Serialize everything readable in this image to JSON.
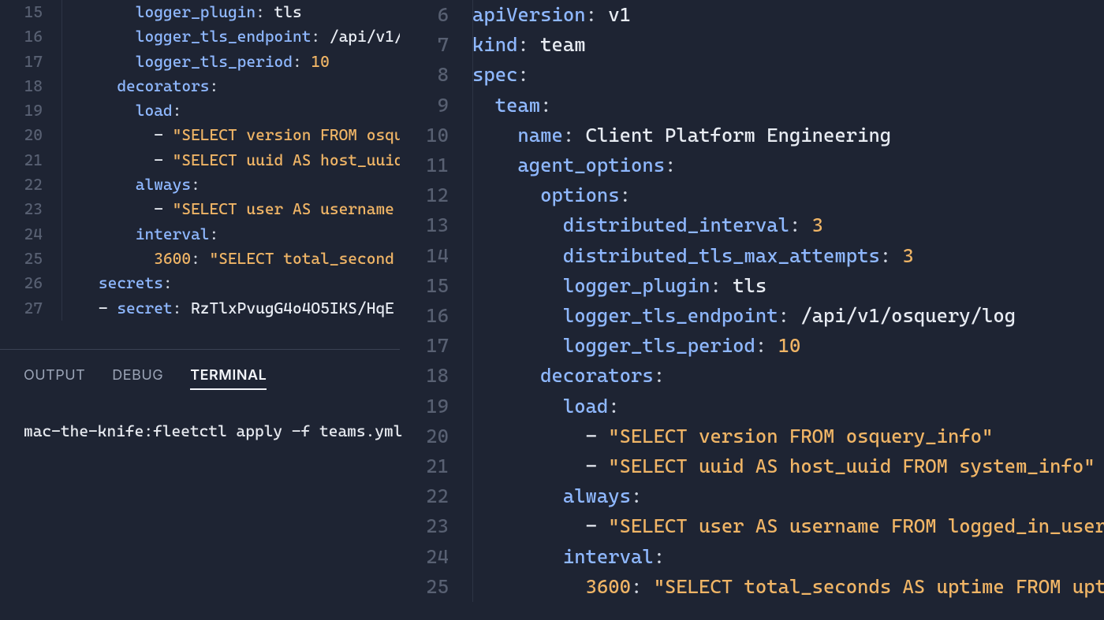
{
  "left_editor": {
    "start": 15,
    "indent_guide_col": 78,
    "lines": [
      [
        [
          "        ",
          "punct"
        ],
        [
          "logger_plugin",
          "key"
        ],
        [
          ": ",
          "punct"
        ],
        [
          "tls",
          "val"
        ]
      ],
      [
        [
          "        ",
          "punct"
        ],
        [
          "logger_tls_endpoint",
          "key"
        ],
        [
          ": ",
          "punct"
        ],
        [
          "/api/v1/",
          "val"
        ]
      ],
      [
        [
          "        ",
          "punct"
        ],
        [
          "logger_tls_period",
          "key"
        ],
        [
          ": ",
          "punct"
        ],
        [
          "10",
          "num"
        ]
      ],
      [
        [
          "      ",
          "punct"
        ],
        [
          "decorators",
          "key"
        ],
        [
          ":",
          "punct"
        ]
      ],
      [
        [
          "        ",
          "punct"
        ],
        [
          "load",
          "key"
        ],
        [
          ":",
          "punct"
        ]
      ],
      [
        [
          "          ",
          "punct"
        ],
        [
          "- ",
          "dash"
        ],
        [
          "\"SELECT version FROM osqu",
          "str"
        ]
      ],
      [
        [
          "          ",
          "punct"
        ],
        [
          "- ",
          "dash"
        ],
        [
          "\"SELECT uuid AS host_uuid",
          "str"
        ]
      ],
      [
        [
          "        ",
          "punct"
        ],
        [
          "always",
          "key"
        ],
        [
          ":",
          "punct"
        ]
      ],
      [
        [
          "          ",
          "punct"
        ],
        [
          "- ",
          "dash"
        ],
        [
          "\"SELECT user AS username",
          "str"
        ]
      ],
      [
        [
          "        ",
          "punct"
        ],
        [
          "interval",
          "key"
        ],
        [
          ":",
          "punct"
        ]
      ],
      [
        [
          "          ",
          "punct"
        ],
        [
          "3600",
          "num"
        ],
        [
          ": ",
          "punct"
        ],
        [
          "\"SELECT total_second",
          "str"
        ]
      ],
      [
        [
          "    ",
          "punct"
        ],
        [
          "secrets",
          "key"
        ],
        [
          ":",
          "punct"
        ]
      ],
      [
        [
          "    ",
          "punct"
        ],
        [
          "- ",
          "dash"
        ],
        [
          "secret",
          "key"
        ],
        [
          ": ",
          "punct"
        ],
        [
          "RzTlxPvugG4o4O5IKS/HqE",
          "val"
        ]
      ]
    ]
  },
  "right_editor": {
    "start": 6,
    "indent_guide_col": 92,
    "lines": [
      [
        [
          "",
          "punct"
        ],
        [
          "apiVersion",
          "key"
        ],
        [
          ": ",
          "punct"
        ],
        [
          "v1",
          "val"
        ]
      ],
      [
        [
          "",
          "punct"
        ],
        [
          "kind",
          "key"
        ],
        [
          ": ",
          "punct"
        ],
        [
          "team",
          "val"
        ]
      ],
      [
        [
          "",
          "punct"
        ],
        [
          "spec",
          "key"
        ],
        [
          ":",
          "punct"
        ]
      ],
      [
        [
          "  ",
          "punct"
        ],
        [
          "team",
          "key"
        ],
        [
          ":",
          "punct"
        ]
      ],
      [
        [
          "    ",
          "punct"
        ],
        [
          "name",
          "key"
        ],
        [
          ": ",
          "punct"
        ],
        [
          "Client Platform Engineering",
          "val"
        ]
      ],
      [
        [
          "    ",
          "punct"
        ],
        [
          "agent_options",
          "key"
        ],
        [
          ":",
          "punct"
        ]
      ],
      [
        [
          "      ",
          "punct"
        ],
        [
          "options",
          "key"
        ],
        [
          ":",
          "punct"
        ]
      ],
      [
        [
          "        ",
          "punct"
        ],
        [
          "distributed_interval",
          "key"
        ],
        [
          ": ",
          "punct"
        ],
        [
          "3",
          "num"
        ]
      ],
      [
        [
          "        ",
          "punct"
        ],
        [
          "distributed_tls_max_attempts",
          "key"
        ],
        [
          ": ",
          "punct"
        ],
        [
          "3",
          "num"
        ]
      ],
      [
        [
          "        ",
          "punct"
        ],
        [
          "logger_plugin",
          "key"
        ],
        [
          ": ",
          "punct"
        ],
        [
          "tls",
          "val"
        ]
      ],
      [
        [
          "        ",
          "punct"
        ],
        [
          "logger_tls_endpoint",
          "key"
        ],
        [
          ": ",
          "punct"
        ],
        [
          "/api/v1/osquery/log",
          "val"
        ]
      ],
      [
        [
          "        ",
          "punct"
        ],
        [
          "logger_tls_period",
          "key"
        ],
        [
          ": ",
          "punct"
        ],
        [
          "10",
          "num"
        ]
      ],
      [
        [
          "      ",
          "punct"
        ],
        [
          "decorators",
          "key"
        ],
        [
          ":",
          "punct"
        ]
      ],
      [
        [
          "        ",
          "punct"
        ],
        [
          "load",
          "key"
        ],
        [
          ":",
          "punct"
        ]
      ],
      [
        [
          "          ",
          "punct"
        ],
        [
          "- ",
          "dash"
        ],
        [
          "\"SELECT version FROM osquery_info\"",
          "str"
        ]
      ],
      [
        [
          "          ",
          "punct"
        ],
        [
          "- ",
          "dash"
        ],
        [
          "\"SELECT uuid AS host_uuid FROM system_info\"",
          "str"
        ]
      ],
      [
        [
          "        ",
          "punct"
        ],
        [
          "always",
          "key"
        ],
        [
          ":",
          "punct"
        ]
      ],
      [
        [
          "          ",
          "punct"
        ],
        [
          "- ",
          "dash"
        ],
        [
          "\"SELECT user AS username FROM logged_in_users",
          "str"
        ]
      ],
      [
        [
          "        ",
          "punct"
        ],
        [
          "interval",
          "key"
        ],
        [
          ":",
          "punct"
        ]
      ],
      [
        [
          "          ",
          "punct"
        ],
        [
          "3600",
          "num"
        ],
        [
          ": ",
          "punct"
        ],
        [
          "\"SELECT total_seconds AS uptime FROM upti",
          "str"
        ]
      ]
    ]
  },
  "panel": {
    "tabs": [
      "OUTPUT",
      "DEBUG",
      "TERMINAL"
    ],
    "active_tab": 2,
    "terminal_line": "mac-the-knife:fleetctl apply -f teams.yml"
  }
}
